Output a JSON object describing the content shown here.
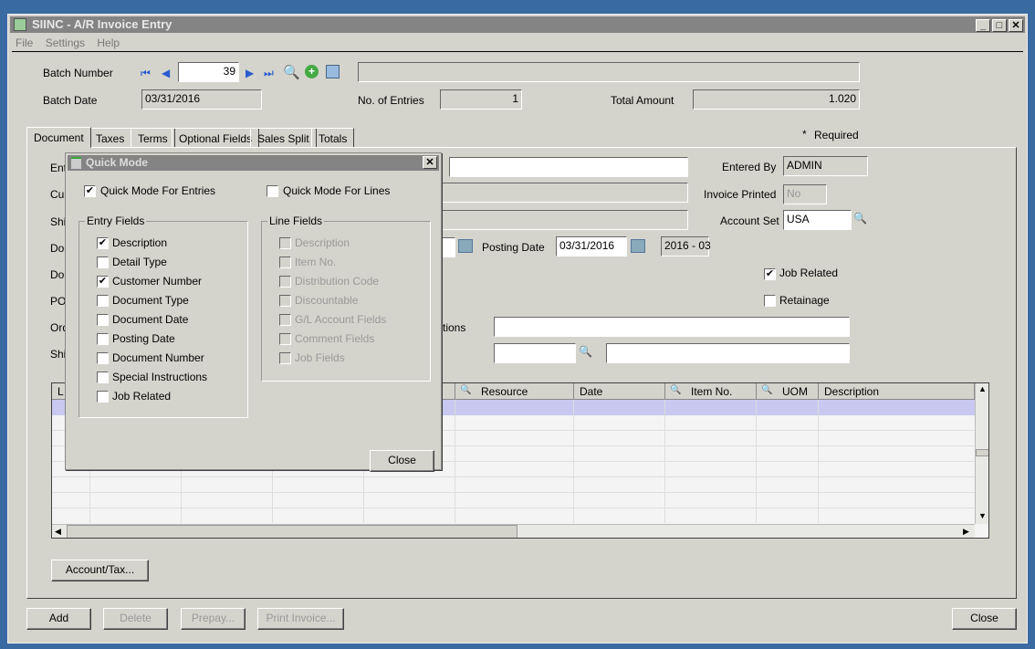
{
  "window": {
    "title": "SIINC - A/R Invoice Entry",
    "minimize": "_",
    "maximize": "□",
    "close": "✕"
  },
  "menu": [
    "File",
    "Settings",
    "Help"
  ],
  "header": {
    "batch_number_label": "Batch Number",
    "batch_number": "39",
    "batch_description": "",
    "batch_date_label": "Batch Date",
    "batch_date": "03/31/2016",
    "entries_label": "No. of Entries",
    "entries": "1",
    "total_label": "Total Amount",
    "total": "1.020"
  },
  "tabs": [
    "Document",
    "Taxes",
    "Terms",
    "Optional Fields",
    "Sales Split",
    "Totals"
  ],
  "required_note": "Required",
  "required_mark": "*",
  "left_labels": [
    "Ent",
    "Cus",
    "Shi",
    "Doc",
    "Doc",
    "PO",
    "Ord",
    "Shi"
  ],
  "right": {
    "entered_by_label": "Entered By",
    "entered_by": "ADMIN",
    "invoice_printed_label": "Invoice Printed",
    "invoice_printed": "No",
    "account_set_label": "Account Set",
    "account_set": "USA",
    "posting_date_label": "Posting Date",
    "posting_date": "03/31/2016",
    "period": "2016 - 03",
    "job_related_label": "Job Related",
    "job_related": true,
    "retainage_label": "Retainage",
    "retainage": false,
    "instructions_label": "tions"
  },
  "grid": {
    "columns": [
      "L",
      "",
      "",
      "",
      "",
      "Resource",
      "Date",
      "Item No.",
      "UOM",
      "Description"
    ]
  },
  "buttons": {
    "account_tax": "Account/Tax...",
    "add": "Add",
    "delete": "Delete",
    "prepay": "Prepay...",
    "print_invoice": "Print Invoice...",
    "close": "Close"
  },
  "dialog": {
    "title": "Quick Mode",
    "close_x": "✕",
    "quick_entries_label": "Quick Mode For Entries",
    "quick_entries": true,
    "quick_lines_label": "Quick Mode For Lines",
    "quick_lines": false,
    "entry_fields_label": "Entry Fields",
    "entry_fields": [
      {
        "label": "Description",
        "checked": true
      },
      {
        "label": "Detail Type",
        "checked": false
      },
      {
        "label": "Customer Number",
        "checked": true
      },
      {
        "label": "Document Type",
        "checked": false
      },
      {
        "label": "Document Date",
        "checked": false
      },
      {
        "label": "Posting Date",
        "checked": false
      },
      {
        "label": "Document Number",
        "checked": false
      },
      {
        "label": "Special Instructions",
        "checked": false
      },
      {
        "label": "Job Related",
        "checked": false
      }
    ],
    "line_fields_label": "Line Fields",
    "line_fields": [
      {
        "label": "Description",
        "checked": false
      },
      {
        "label": "Item No.",
        "checked": false
      },
      {
        "label": "Distribution Code",
        "checked": false
      },
      {
        "label": "Discountable",
        "checked": false
      },
      {
        "label": "G/L Account Fields",
        "checked": false
      },
      {
        "label": "Comment Fields",
        "checked": false
      },
      {
        "label": "Job Fields",
        "checked": false
      }
    ],
    "close_button": "Close"
  },
  "colors": {
    "desktop": "#3a6aa2",
    "titlebar": "#848484",
    "face": "#d5d4cc",
    "selected_row": "#c8c8f0"
  }
}
